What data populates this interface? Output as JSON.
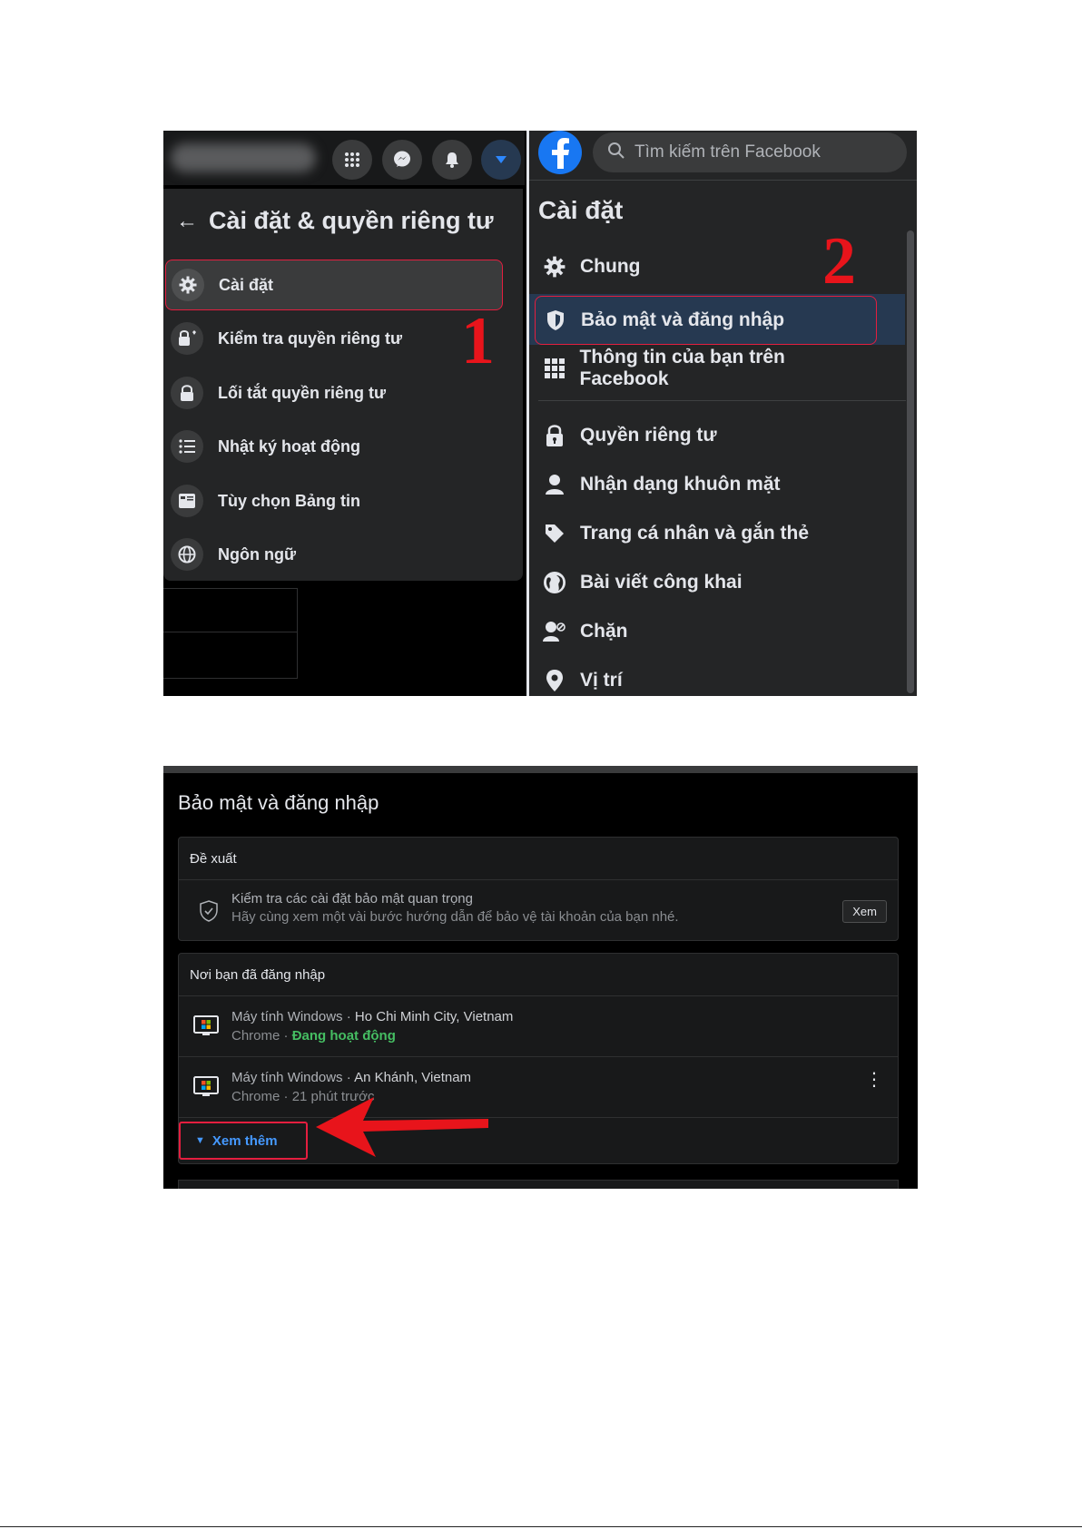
{
  "screen1": {
    "left_menu": {
      "title": "Cài đặt & quyền riêng tư",
      "items": [
        {
          "label": "Cài đặt",
          "icon": "gear-icon"
        },
        {
          "label": "Kiểm tra quyền riêng tư",
          "icon": "lock-heart-icon"
        },
        {
          "label": "Lối tắt quyền riêng tư",
          "icon": "lock-icon"
        },
        {
          "label": "Nhật ký hoạt động",
          "icon": "list-icon"
        },
        {
          "label": "Tùy chọn Bảng tin",
          "icon": "feed-icon"
        },
        {
          "label": "Ngôn ngữ",
          "icon": "globe-icon"
        }
      ],
      "step_number": "1"
    },
    "right_settings": {
      "search_placeholder": "Tìm kiếm trên Facebook",
      "title": "Cài đặt",
      "items": [
        {
          "label": "Chung",
          "icon": "gear-icon"
        },
        {
          "label": "Bảo mật và đăng nhập",
          "icon": "shield-icon"
        },
        {
          "label": "Thông tin của bạn trên Facebook",
          "icon": "grid-icon"
        },
        {
          "label": "Quyền riêng tư",
          "icon": "lock-icon"
        },
        {
          "label": "Nhận dạng khuôn mặt",
          "icon": "face-icon"
        },
        {
          "label": "Trang cá nhân và gắn thẻ",
          "icon": "tag-icon"
        },
        {
          "label": "Bài viết công khai",
          "icon": "globe-icon"
        },
        {
          "label": "Chặn",
          "icon": "block-user-icon"
        },
        {
          "label": "Vị trí",
          "icon": "location-pin-icon"
        }
      ],
      "step_number": "2"
    }
  },
  "screen2": {
    "title": "Bảo mật và đăng nhập",
    "recommend": {
      "heading": "Đề xuất",
      "line1": "Kiểm tra các cài đặt bảo mật quan trọng",
      "line2": "Hãy cùng xem một vài bước hướng dẫn để bảo vệ tài khoản của bạn nhé.",
      "button": "Xem"
    },
    "logins": {
      "heading": "Nơi bạn đã đăng nhập",
      "sessions": [
        {
          "device": "Máy tính Windows",
          "sep": " · ",
          "place": "Ho Chi Minh City, Vietnam",
          "browser": "Chrome",
          "status": "Đang hoạt động"
        },
        {
          "device": "Máy tính Windows",
          "sep": " · ",
          "place": "An Khánh, Vietnam",
          "browser": "Chrome",
          "status": "21 phút trước"
        }
      ],
      "see_more": "Xem thêm"
    }
  },
  "colors": {
    "accent_red": "#e41e3f",
    "fb_blue": "#1877f2",
    "link_blue": "#4599ff",
    "active_green": "#45bd62"
  }
}
